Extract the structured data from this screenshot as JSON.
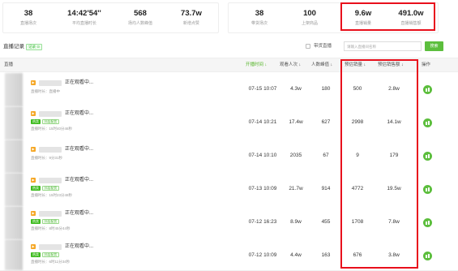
{
  "summary": {
    "live_stats": [
      {
        "value": "38",
        "label": "直播场次"
      },
      {
        "value": "14:42'54''",
        "label": "平均直播时长"
      },
      {
        "value": "568",
        "label": "场均人数峰值"
      },
      {
        "value": "73.7w",
        "label": "新增点赞"
      }
    ],
    "goods_stats": [
      {
        "value": "38",
        "label": "带货场次"
      },
      {
        "value": "100",
        "label": "上架商品"
      },
      {
        "value": "9.6w",
        "label": "直播销量"
      },
      {
        "value": "491.0w",
        "label": "直播销售额"
      }
    ]
  },
  "section": {
    "title": "直播记录",
    "badge": "记录 ⊙",
    "filter_label": "带货直播",
    "search_placeholder": "请输入直播间名称",
    "search_button": "搜索"
  },
  "table": {
    "columns": [
      "直播",
      "开播时间 ↓",
      "观看人次 ↓",
      "人数峰值 ↓",
      "预估销量 ↓",
      "预估销售额 ↓",
      "操作"
    ],
    "rows": [
      {
        "status": "正在观看中...",
        "hot": "",
        "collect": "",
        "duration": "直播时长：直播中",
        "start": "07-15 10:07",
        "views": "4.3w",
        "peak": "180",
        "sales": "500",
        "revenue": "2.8w"
      },
      {
        "status": "正在观看中...",
        "hot": "热卖",
        "collect": "抖店配货",
        "duration": "直播时长：15时40分46秒",
        "start": "07-14 10:21",
        "views": "17.4w",
        "peak": "627",
        "sales": "2998",
        "revenue": "14.1w"
      },
      {
        "status": "正在观看中...",
        "hot": "",
        "collect": "",
        "duration": "直播时长：9分31秒",
        "start": "07-14 10:10",
        "views": "2035",
        "peak": "67",
        "sales": "9",
        "revenue": "179"
      },
      {
        "status": "正在观看中...",
        "hot": "热卖",
        "collect": "抖店配货",
        "duration": "直播时长：15时23分48秒",
        "start": "07-13 10:09",
        "views": "21.7w",
        "peak": "914",
        "sales": "4772",
        "revenue": "19.5w"
      },
      {
        "status": "正在观看中...",
        "hot": "热卖",
        "collect": "抖店配货",
        "duration": "直播时长：8时45分44秒",
        "start": "07-12 16:23",
        "views": "8.9w",
        "peak": "455",
        "sales": "1708",
        "revenue": "7.8w"
      },
      {
        "status": "正在观看中...",
        "hot": "热卖",
        "collect": "抖店配货",
        "duration": "直播时长：6时11分34秒",
        "start": "07-12 10:09",
        "views": "4.4w",
        "peak": "163",
        "sales": "676",
        "revenue": "3.8w"
      }
    ]
  },
  "colors": {
    "accent_green": "#5cbe3d",
    "highlight_red": "#e8101c",
    "tag_orange": "#f5a623"
  }
}
